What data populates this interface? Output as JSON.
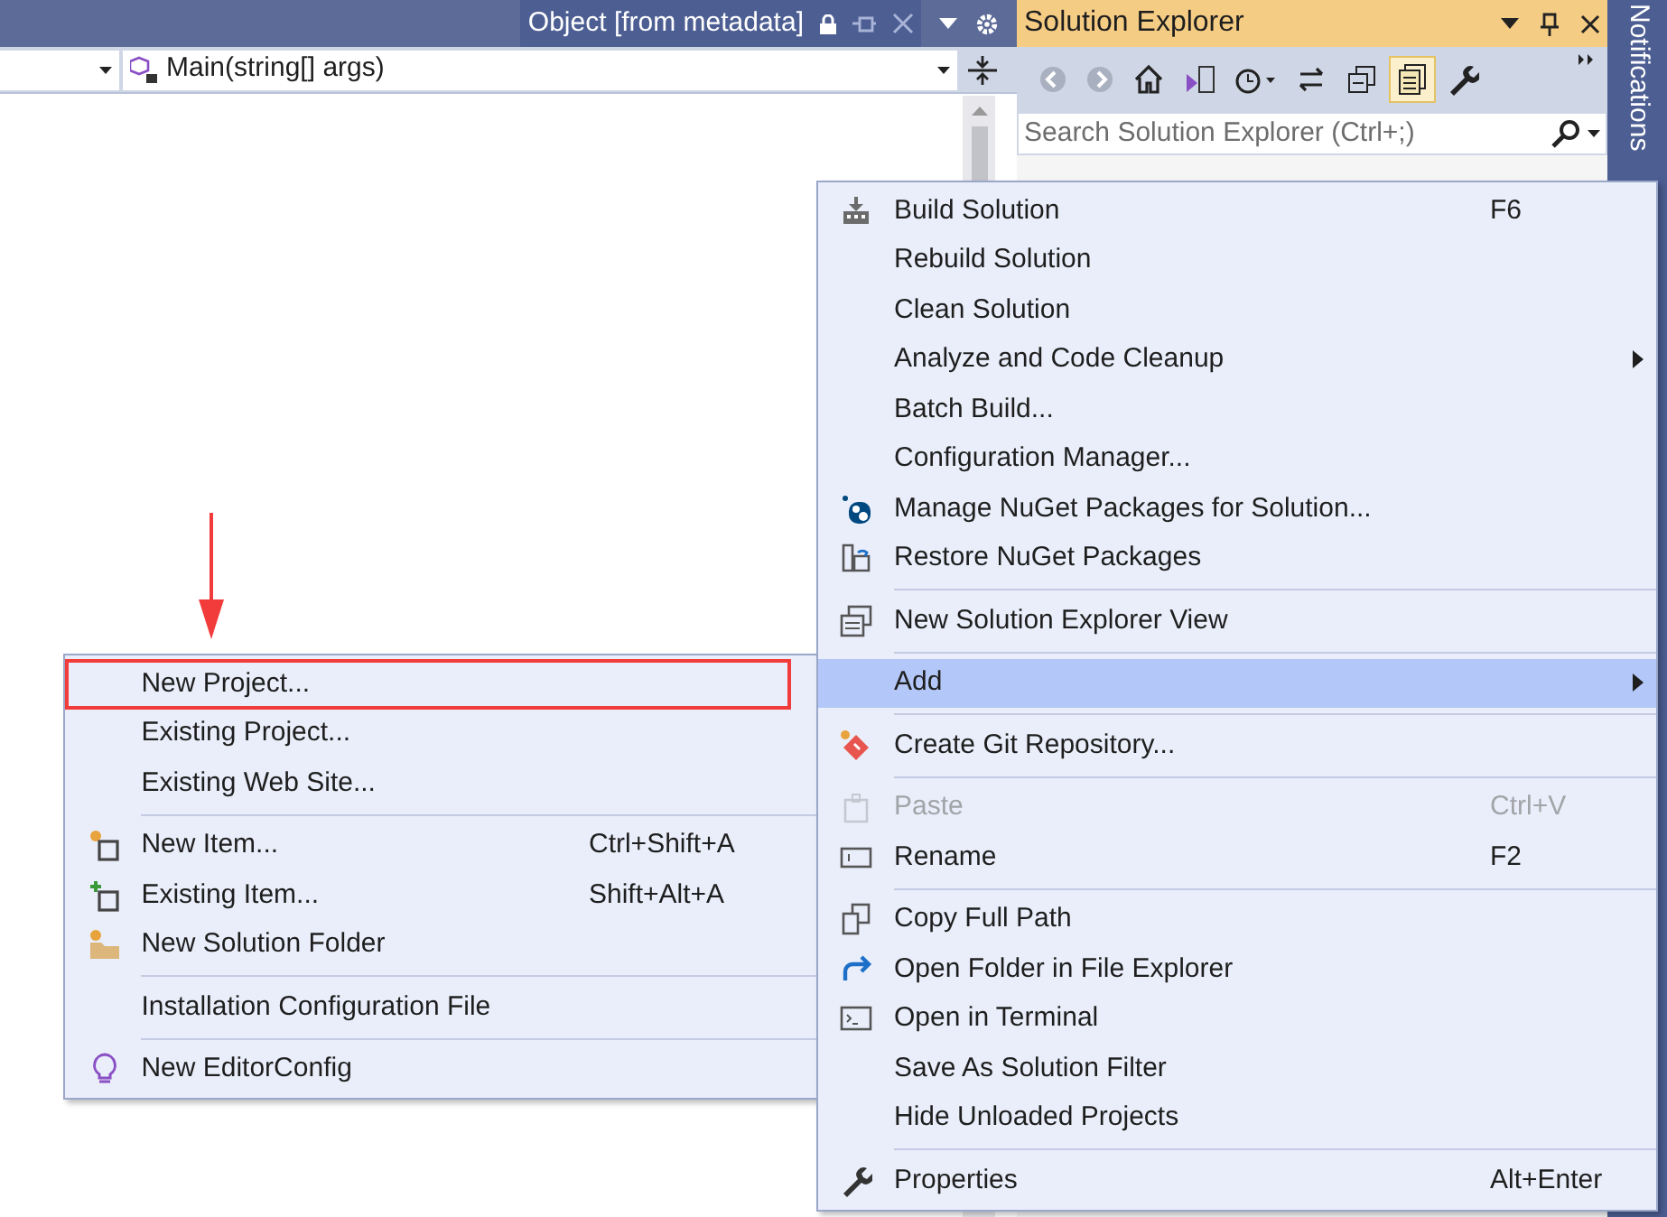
{
  "document_tab": {
    "title": "Object [from metadata]"
  },
  "navigation_bar": {
    "member": "Main(string[] args)"
  },
  "solution_explorer": {
    "title": "Solution Explorer",
    "toolbar_buttons": [
      {
        "selected": false
      },
      {
        "selected": false
      },
      {
        "selected": false
      },
      {
        "selected": false
      },
      {
        "selected": false
      },
      {
        "selected": false
      },
      {
        "selected": false
      },
      {
        "selected": true
      },
      {
        "selected": false
      }
    ],
    "search": {
      "placeholder": "Search Solution Explorer (Ctrl+;)"
    }
  },
  "notifications": {
    "label": "Notifications"
  },
  "context_menu": {
    "items": [
      {
        "kind": "item",
        "label": "Build Solution",
        "shortcut": "F6",
        "has_submenu": false,
        "disabled": false,
        "selected": false
      },
      {
        "kind": "item",
        "label": "Rebuild Solution",
        "has_submenu": false,
        "disabled": false,
        "selected": false
      },
      {
        "kind": "item",
        "label": "Clean Solution",
        "has_submenu": false,
        "disabled": false,
        "selected": false
      },
      {
        "kind": "item",
        "label": "Analyze and Code Cleanup",
        "has_submenu": true,
        "disabled": false,
        "selected": false
      },
      {
        "kind": "item",
        "label": "Batch Build...",
        "has_submenu": false,
        "disabled": false,
        "selected": false
      },
      {
        "kind": "item",
        "label": "Configuration Manager...",
        "has_submenu": false,
        "disabled": false,
        "selected": false
      },
      {
        "kind": "item",
        "label": "Manage NuGet Packages for Solution...",
        "has_submenu": false,
        "disabled": false,
        "selected": false
      },
      {
        "kind": "item",
        "label": "Restore NuGet Packages",
        "has_submenu": false,
        "disabled": false,
        "selected": false
      },
      {
        "kind": "separator"
      },
      {
        "kind": "item",
        "label": "New Solution Explorer View",
        "has_submenu": false,
        "disabled": false,
        "selected": false
      },
      {
        "kind": "separator"
      },
      {
        "kind": "item",
        "label": "Add",
        "has_submenu": true,
        "disabled": false,
        "selected": true
      },
      {
        "kind": "separator"
      },
      {
        "kind": "item",
        "label": "Create Git Repository...",
        "has_submenu": false,
        "disabled": false,
        "selected": false
      },
      {
        "kind": "separator"
      },
      {
        "kind": "item",
        "label": "Paste",
        "shortcut": "Ctrl+V",
        "has_submenu": false,
        "disabled": true,
        "selected": false
      },
      {
        "kind": "item",
        "label": "Rename",
        "shortcut": "F2",
        "has_submenu": false,
        "disabled": false,
        "selected": false
      },
      {
        "kind": "separator"
      },
      {
        "kind": "item",
        "label": "Copy Full Path",
        "has_submenu": false,
        "disabled": false,
        "selected": false
      },
      {
        "kind": "item",
        "label": "Open Folder in File Explorer",
        "has_submenu": false,
        "disabled": false,
        "selected": false
      },
      {
        "kind": "item",
        "label": "Open in Terminal",
        "has_submenu": false,
        "disabled": false,
        "selected": false
      },
      {
        "kind": "item",
        "label": "Save As Solution Filter",
        "has_submenu": false,
        "disabled": false,
        "selected": false
      },
      {
        "kind": "item",
        "label": "Hide Unloaded Projects",
        "has_submenu": false,
        "disabled": false,
        "selected": false
      },
      {
        "kind": "separator"
      },
      {
        "kind": "item",
        "label": "Properties",
        "shortcut": "Alt+Enter",
        "has_submenu": false,
        "disabled": false,
        "selected": false
      }
    ]
  },
  "add_submenu": {
    "items": [
      {
        "kind": "item",
        "label": "New Project...",
        "highlighted": true
      },
      {
        "kind": "item",
        "label": "Existing Project...",
        "highlighted": false
      },
      {
        "kind": "item",
        "label": "Existing Web Site...",
        "highlighted": false
      },
      {
        "kind": "separator"
      },
      {
        "kind": "item",
        "label": "New Item...",
        "shortcut": "Ctrl+Shift+A",
        "highlighted": false
      },
      {
        "kind": "item",
        "label": "Existing Item...",
        "shortcut": "Shift+Alt+A",
        "highlighted": false
      },
      {
        "kind": "item",
        "label": "New Solution Folder",
        "highlighted": false
      },
      {
        "kind": "separator"
      },
      {
        "kind": "item",
        "label": "Installation Configuration File",
        "highlighted": false
      },
      {
        "kind": "separator"
      },
      {
        "kind": "item",
        "label": "New EditorConfig",
        "highlighted": false
      }
    ]
  }
}
